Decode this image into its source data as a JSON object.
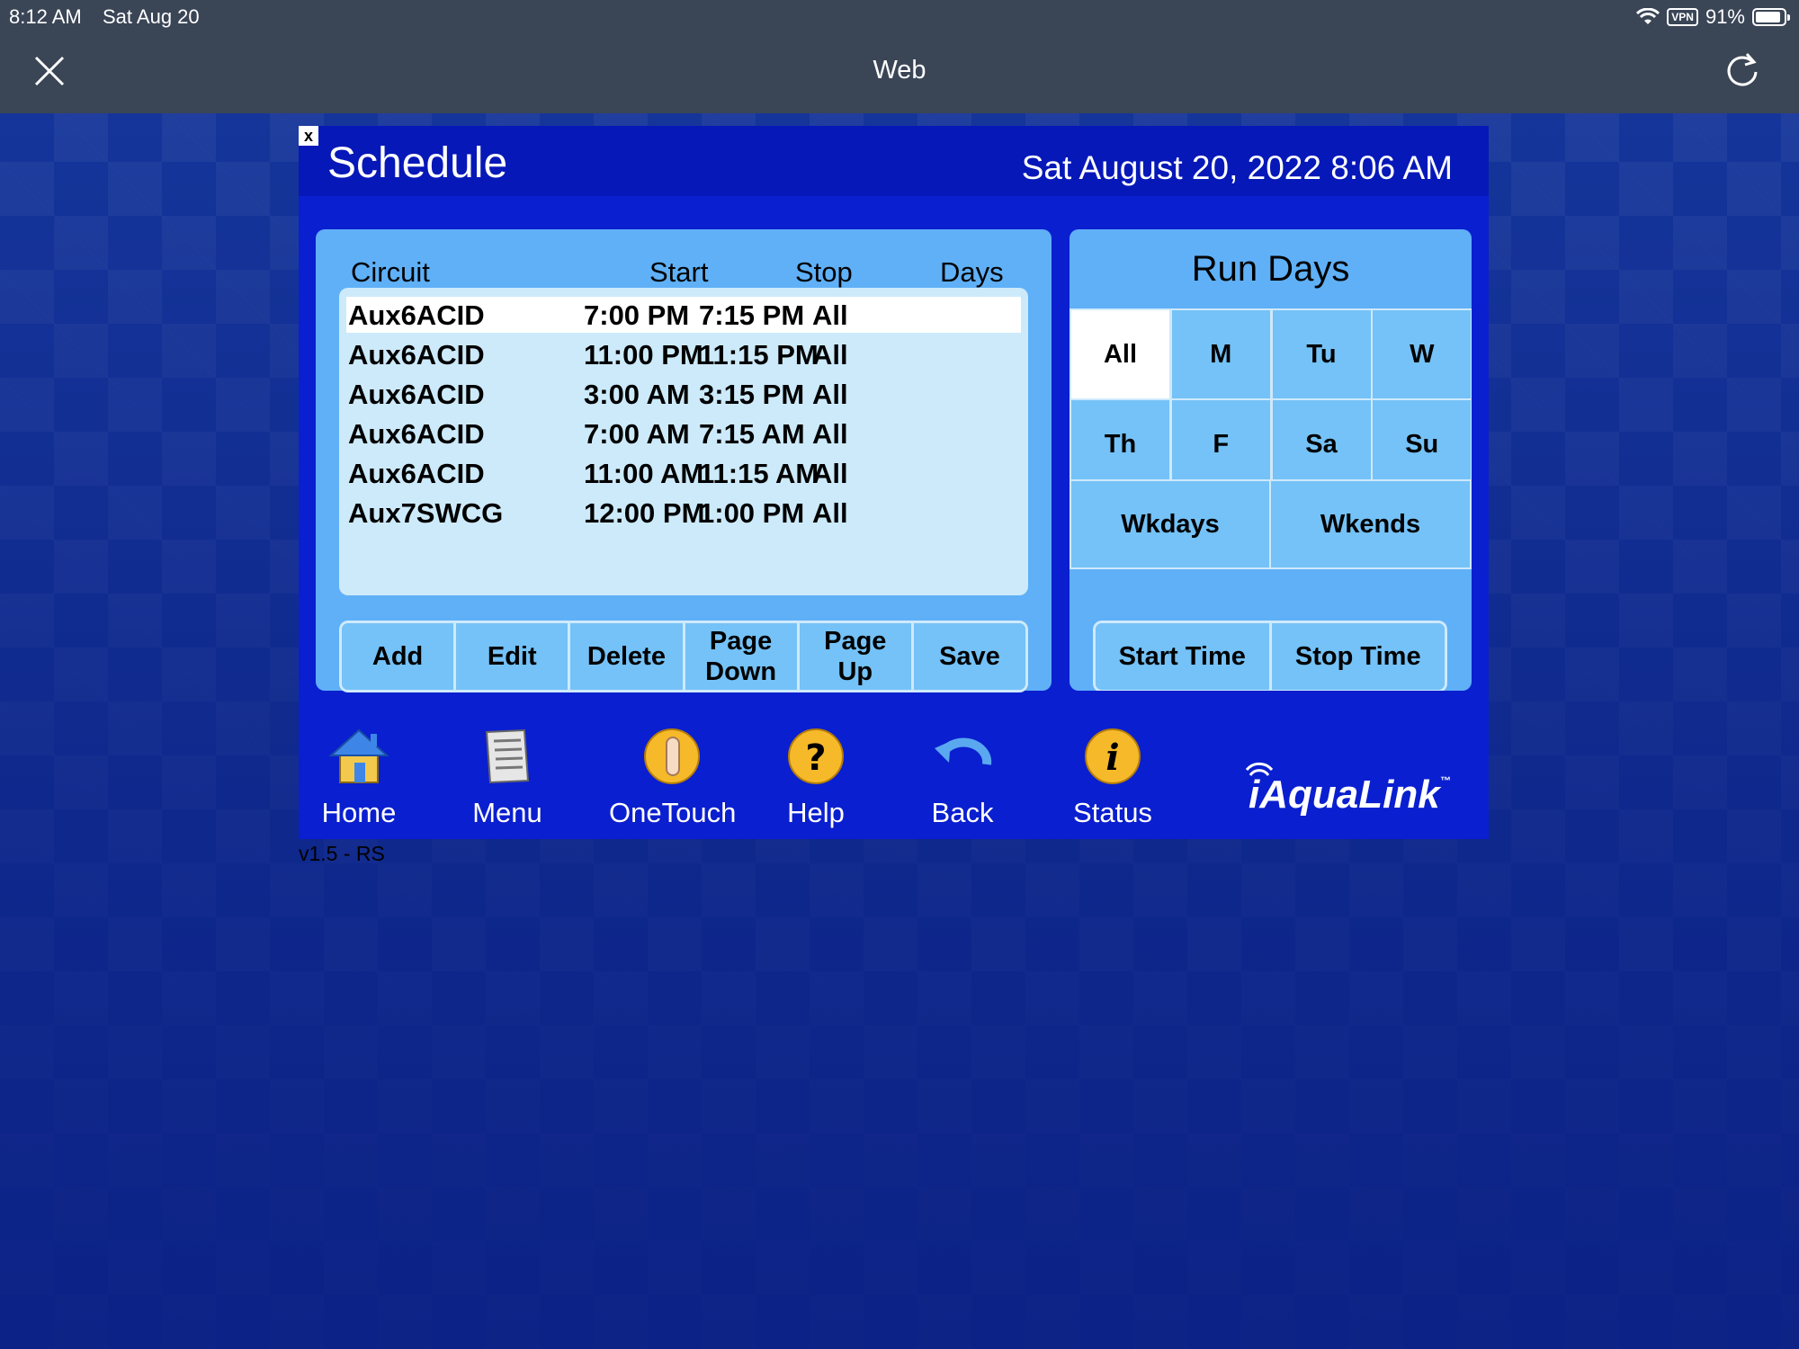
{
  "status_bar": {
    "time": "8:12 AM",
    "date": "Sat Aug 20",
    "vpn": "VPN",
    "battery": "91%",
    "battery_level": 0.91
  },
  "browser": {
    "title": "Web",
    "close_icon": "close-icon",
    "reload_icon": "reload-icon"
  },
  "panel": {
    "title": "Schedule",
    "datetime": "Sat August 20, 2022 8:06 AM",
    "close_glyph": "x"
  },
  "schedule": {
    "columns": [
      "Circuit",
      "Start",
      "Stop",
      "Days"
    ],
    "rows": [
      {
        "circuit": "Aux6ACID",
        "start": "7:00 PM",
        "stop": "7:15 PM",
        "days": "All",
        "selected": true
      },
      {
        "circuit": "Aux6ACID",
        "start": "11:00 PM",
        "stop": "11:15 PM",
        "days": "All",
        "selected": false
      },
      {
        "circuit": "Aux6ACID",
        "start": "3:00 AM",
        "stop": "3:15 PM",
        "days": "All",
        "selected": false
      },
      {
        "circuit": "Aux6ACID",
        "start": "7:00 AM",
        "stop": "7:15 AM",
        "days": "All",
        "selected": false
      },
      {
        "circuit": "Aux6ACID",
        "start": "11:00 AM",
        "stop": "11:15 AM",
        "days": "All",
        "selected": false
      },
      {
        "circuit": "Aux7SWCG",
        "start": "12:00 PM",
        "stop": "1:00 PM",
        "days": "All",
        "selected": false
      }
    ],
    "buttons": {
      "add": "Add",
      "edit": "Edit",
      "delete": "Delete",
      "page_down_1": "Page",
      "page_down_2": "Down",
      "page_up_1": "Page",
      "page_up_2": "Up",
      "save": "Save"
    }
  },
  "run_days": {
    "title": "Run Days",
    "days": [
      "All",
      "M",
      "Tu",
      "W",
      "Th",
      "F",
      "Sa",
      "Su"
    ],
    "selected": "All",
    "weekdays": "Wkdays",
    "weekends": "Wkends",
    "start_time": "Start Time",
    "stop_time": "Stop Time"
  },
  "nav": {
    "home": "Home",
    "menu": "Menu",
    "onetouch": "OneTouch",
    "help": "Help",
    "back": "Back",
    "status": "Status"
  },
  "brand": {
    "name": "iAquaLink",
    "tm": "™"
  },
  "version": "v1.5 - RS",
  "colors": {
    "panel": "#0a1fcf",
    "card": "#5fb0f7",
    "button": "#74c2f7",
    "list": "#cdeafa",
    "page_bg": "#15359a",
    "topbar": "#3a4556"
  }
}
